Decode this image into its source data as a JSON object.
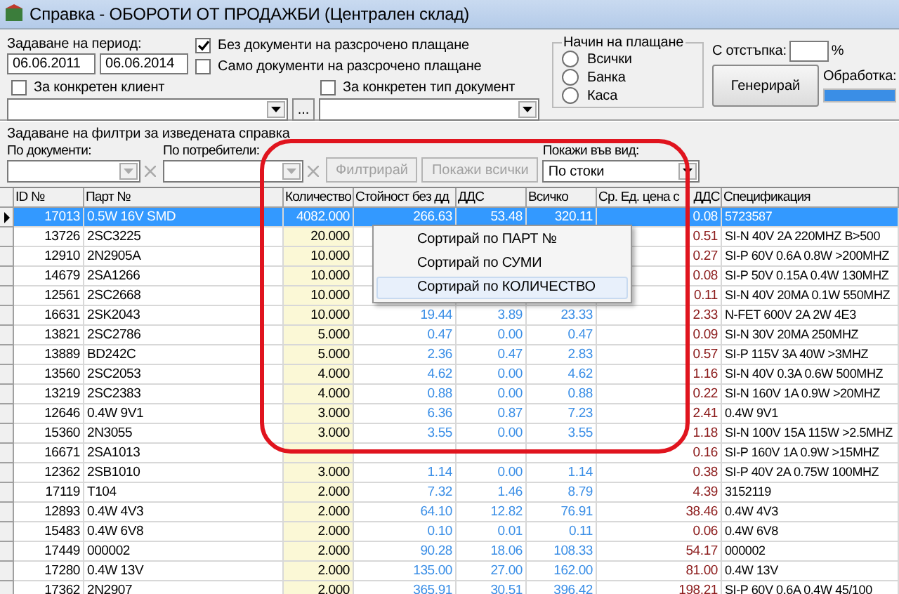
{
  "window": {
    "title": "Справка - ОБОРОТИ ОТ ПРОДАЖБИ (Централен склад)"
  },
  "period": {
    "label": "Задаване на период:",
    "from": "06.06.2011",
    "to": "06.06.2014"
  },
  "installment_options": [
    {
      "label": "Без документи на разсрочено плащане",
      "checked": true
    },
    {
      "label": "Само документи на разсрочено плащане",
      "checked": false
    }
  ],
  "client_filter": {
    "label": "За конкретен клиент",
    "checked": false,
    "browse_button": "..."
  },
  "document_type_filter": {
    "label": "За конкретен тип документ",
    "checked": false
  },
  "payment_method": {
    "title": "Начин на плащане",
    "options": [
      {
        "label": "Всички",
        "selected": false
      },
      {
        "label": "Банка",
        "selected": false
      },
      {
        "label": "Каса",
        "selected": false
      }
    ]
  },
  "discount": {
    "label": "С отстъпка:",
    "unit": "%"
  },
  "generate_button": "Генерирай",
  "processing": {
    "label": "Обработка:",
    "level": 1
  },
  "filters": {
    "title": "Задаване на филтри за изведената справка",
    "by_documents": "По документи:",
    "by_users": "По потребители:",
    "filter_button": {
      "label": "Филтрирай",
      "disabled": true
    },
    "show_all_button": {
      "label": "Покажи всички",
      "disabled": true
    },
    "view": {
      "label": "Покажи във вид:",
      "value": "По стоки"
    }
  },
  "table": {
    "columns": [
      {
        "label": "ID №",
        "kind": "id"
      },
      {
        "label": "Парт №",
        "kind": "part"
      },
      {
        "label": "Количество",
        "kind": "quantity"
      },
      {
        "label": "Стойност без дд",
        "kind": "value"
      },
      {
        "label": "ДДС",
        "kind": "vat"
      },
      {
        "label": "Всичко",
        "kind": "total"
      },
      {
        "label": "Ср. Ед. цена с ДДС",
        "kind": "avg_price"
      },
      {
        "label": "Спецификация",
        "kind": "spec"
      }
    ],
    "rows": [
      {
        "selected": true,
        "id": "17013",
        "part": "0.5W 16V SMD",
        "quantity": "4082.000",
        "value": "266.63",
        "vat": "53.48",
        "total": "320.11",
        "avg_price": "0.08",
        "spec": "5723587"
      },
      {
        "selected": false,
        "id": "13726",
        "part": "2SC3225",
        "quantity": "20.000",
        "avg_price": "0.51",
        "spec": "SI-N 40V 2A 220MHZ B>500"
      },
      {
        "selected": false,
        "id": "12910",
        "part": "2N2905A",
        "quantity": "10.000",
        "avg_price": "0.27",
        "spec": "SI-P 60V 0.6A 0.8W >200MHZ"
      },
      {
        "selected": false,
        "id": "14679",
        "part": "2SA1266",
        "quantity": "10.000",
        "avg_price": "0.08",
        "spec": "SI-P 50V 0.15A 0.4W 130MHZ"
      },
      {
        "selected": false,
        "id": "12561",
        "part": "2SC2668",
        "quantity": "10.000",
        "avg_price": "0.11",
        "spec": "SI-N 40V 20MA 0.1W 550MHZ"
      },
      {
        "selected": false,
        "id": "16631",
        "part": "2SK2043",
        "quantity": "10.000",
        "value": "19.44",
        "vat": "3.89",
        "total": "23.33",
        "avg_price": "2.33",
        "spec": "N-FET 600V 2A 2W 4E3"
      },
      {
        "selected": false,
        "id": "13821",
        "part": "2SC2786",
        "quantity": "5.000",
        "value": "0.47",
        "vat": "0.00",
        "total": "0.47",
        "avg_price": "0.09",
        "spec": "SI-N 30V 20MA 250MHZ"
      },
      {
        "selected": false,
        "id": "13889",
        "part": "BD242C",
        "quantity": "5.000",
        "value": "2.36",
        "vat": "0.47",
        "total": "2.83",
        "avg_price": "0.57",
        "spec": "SI-P 115V 3A 40W >3MHZ"
      },
      {
        "selected": false,
        "id": "13560",
        "part": "2SC2053",
        "quantity": "4.000",
        "value": "4.62",
        "vat": "0.00",
        "total": "4.62",
        "avg_price": "1.16",
        "spec": "SI-N 40V 0.3A 0.6W 500MHZ"
      },
      {
        "selected": false,
        "id": "13219",
        "part": "2SC2383",
        "quantity": "4.000",
        "value": "0.88",
        "vat": "0.00",
        "total": "0.88",
        "avg_price": "0.22",
        "spec": "SI-N 160V 1A 0.9W >20MHZ"
      },
      {
        "selected": false,
        "id": "12646",
        "part": "0.4W 9V1",
        "quantity": "3.000",
        "value": "6.36",
        "vat": "0.87",
        "total": "7.23",
        "avg_price": "2.41",
        "spec": "0.4W 9V1"
      },
      {
        "selected": false,
        "id": "15360",
        "part": "2N3055",
        "quantity": "3.000",
        "value": "3.55",
        "vat": "0.00",
        "total": "3.55",
        "avg_price": "1.18",
        "spec": "SI-N 100V 15A 115W >2.5MHZ"
      },
      {
        "selected": false,
        "id": "16671",
        "part": "2SA1013",
        "avg_price": "0.16",
        "spec": "SI-P 160V 1A 0.9W >15MHZ"
      },
      {
        "selected": false,
        "id": "12362",
        "part": "2SB1010",
        "quantity": "3.000",
        "value": "1.14",
        "vat": "0.00",
        "total": "1.14",
        "avg_price": "0.38",
        "spec": "SI-P 40V 2A 0.75W 100MHZ"
      },
      {
        "selected": false,
        "id": "17119",
        "part": "T104",
        "quantity": "2.000",
        "value": "7.32",
        "vat": "1.46",
        "total": "8.79",
        "avg_price": "4.39",
        "spec": "3152119"
      },
      {
        "selected": false,
        "id": "12893",
        "part": "0.4W 4V3",
        "quantity": "2.000",
        "value": "64.10",
        "vat": "12.82",
        "total": "76.91",
        "avg_price": "38.46",
        "spec": "0.4W 4V3"
      },
      {
        "selected": false,
        "id": "15483",
        "part": "0.4W 6V8",
        "quantity": "2.000",
        "value": "0.10",
        "vat": "0.01",
        "total": "0.11",
        "avg_price": "0.06",
        "spec": "0.4W 6V8"
      },
      {
        "selected": false,
        "id": "17449",
        "part": "000002",
        "quantity": "2.000",
        "value": "90.28",
        "vat": "18.06",
        "total": "108.33",
        "avg_price": "54.17",
        "spec": "000002"
      },
      {
        "selected": false,
        "id": "17280",
        "part": "0.4W 13V",
        "quantity": "2.000",
        "value": "135.00",
        "vat": "27.00",
        "total": "162.00",
        "avg_price": "81.00",
        "spec": "0.4W 13V"
      },
      {
        "selected": false,
        "id": "17362",
        "part": "2N2907",
        "quantity": "2.000",
        "value": "365.91",
        "vat": "30.51",
        "total": "396.42",
        "avg_price": "198.21",
        "spec": "SI-P 60V 0.6A 0.4W 45/100"
      }
    ]
  },
  "context_menu": {
    "items": [
      {
        "label": "Сортирай по ПАРТ №",
        "selected": false
      },
      {
        "label": "Сортирай по СУМИ",
        "selected": false
      },
      {
        "label": "Сортирай по КОЛИЧЕСТВО",
        "selected": true
      }
    ]
  }
}
